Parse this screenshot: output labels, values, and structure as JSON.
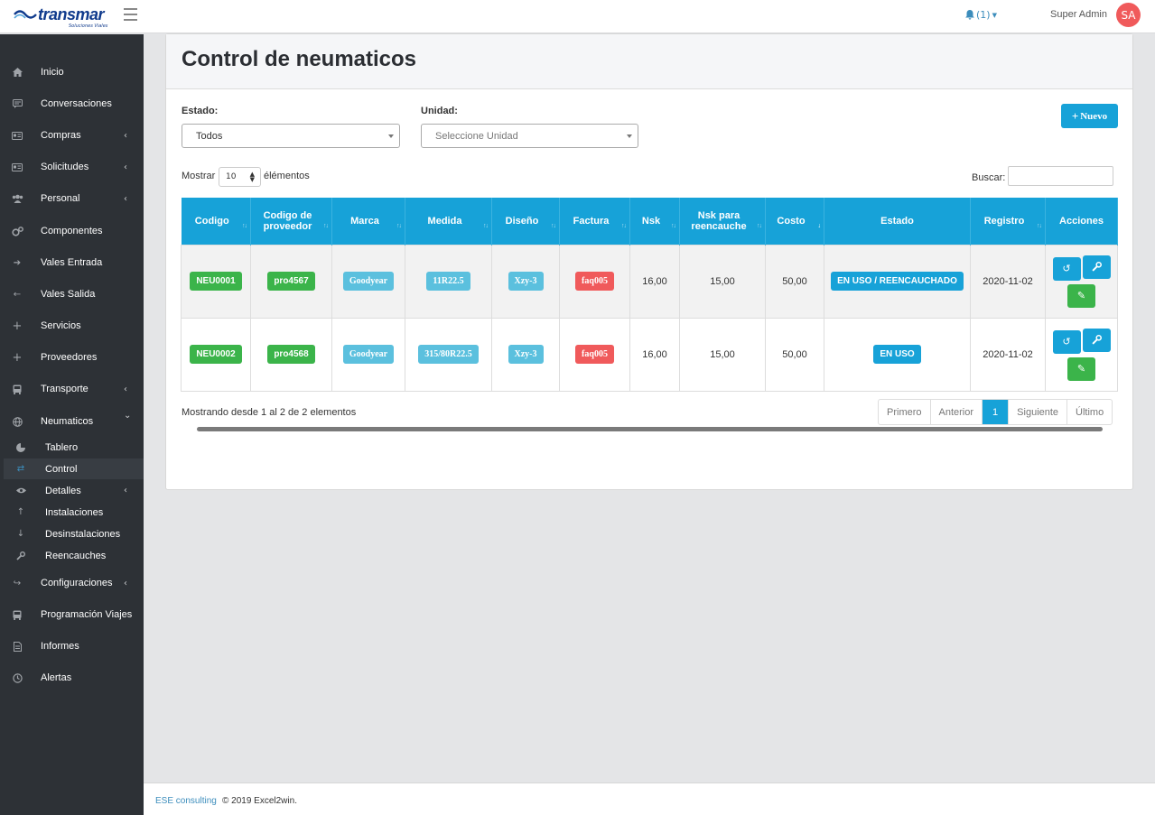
{
  "header": {
    "logo_text": "transmar",
    "logo_sub": "Soluciones Viales",
    "notifications": "(1)",
    "user_name": "Super Admin",
    "avatar_initials": "SA"
  },
  "sidebar": {
    "items": [
      {
        "label": "Inicio",
        "icon": "home-icon"
      },
      {
        "label": "Conversaciones",
        "icon": "chat-icon"
      },
      {
        "label": "Compras",
        "icon": "card-icon",
        "chevron": "‹"
      },
      {
        "label": "Solicitudes",
        "icon": "card-icon",
        "chevron": "‹"
      },
      {
        "label": "Personal",
        "icon": "users-icon",
        "chevron": "‹"
      },
      {
        "label": "Componentes",
        "icon": "cogs-icon"
      },
      {
        "label": "Vales Entrada",
        "icon": "arrow-right-icon"
      },
      {
        "label": "Vales Salida",
        "icon": "arrow-left-icon"
      },
      {
        "label": "Servicios",
        "icon": "plus-icon"
      },
      {
        "label": "Proveedores",
        "icon": "plus-icon"
      },
      {
        "label": "Transporte",
        "icon": "bus-icon",
        "chevron": "‹"
      },
      {
        "label": "Neumaticos",
        "icon": "globe-icon",
        "chevron": "⌄"
      }
    ],
    "sub_items": [
      {
        "label": "Tablero",
        "icon": "pie-chart-icon"
      },
      {
        "label": "Control",
        "icon": "exchange-icon"
      },
      {
        "label": "Detalles",
        "icon": "eye-icon",
        "chevron": "‹"
      },
      {
        "label": "Instalaciones",
        "icon": "arrow-up-icon"
      },
      {
        "label": "Desinstalaciones",
        "icon": "arrow-down-icon"
      },
      {
        "label": "Reencauches",
        "icon": "wrench-icon"
      }
    ],
    "bottom_items": [
      {
        "label": "Configuraciones",
        "icon": "share-icon",
        "chevron": "‹"
      },
      {
        "label": "Programación Viajes",
        "icon": "bus-icon"
      },
      {
        "label": "Informes",
        "icon": "file-icon"
      },
      {
        "label": "Alertas",
        "icon": "clock-icon"
      }
    ]
  },
  "main": {
    "title": "Control de neumaticos",
    "filters": {
      "estado_label": "Estado:",
      "estado_value": "Todos",
      "unidad_label": "Unidad:",
      "unidad_placeholder": "Seleccione Unidad"
    },
    "new_button": "Nuevo",
    "length": {
      "prefix": "Mostrar",
      "value": "10",
      "suffix": "élémentos"
    },
    "search_label": "Buscar:",
    "table": {
      "columns": [
        "Codigo",
        "Codigo de proveedor",
        "Marca",
        "Medida",
        "Diseño",
        "Factura",
        "Nsk",
        "Nsk para reencauche",
        "Costo",
        "Estado",
        "Registro",
        "Acciones"
      ],
      "rows": [
        {
          "codigo": "NEU0001",
          "proveedor": "pro4567",
          "marca": "Goodyear",
          "medida": "11R22.5",
          "diseno": "Xzy-3",
          "factura": "faq005",
          "nsk": "16,00",
          "nsk_re": "15,00",
          "costo": "50,00",
          "estado": "EN USO / REENCAUCHADO",
          "registro": "2020-11-02"
        },
        {
          "codigo": "NEU0002",
          "proveedor": "pro4568",
          "marca": "Goodyear",
          "medida": "315/80R22.5",
          "diseno": "Xzy-3",
          "factura": "faq005",
          "nsk": "16,00",
          "nsk_re": "15,00",
          "costo": "50,00",
          "estado": "EN USO",
          "registro": "2020-11-02"
        }
      ]
    },
    "info": "Mostrando desde 1 al 2 de 2 elementos",
    "pagination": {
      "first": "Primero",
      "prev": "Anterior",
      "current": "1",
      "next": "Siguiente",
      "last": "Último"
    }
  },
  "footer": {
    "link": "ESE consulting",
    "text": "© 2019 Excel2win."
  },
  "colors": {
    "primary": "#17a2d8",
    "success": "#3bb44a",
    "info": "#5bc0de",
    "danger": "#f05a5b",
    "sidebar": "#2d3136"
  }
}
